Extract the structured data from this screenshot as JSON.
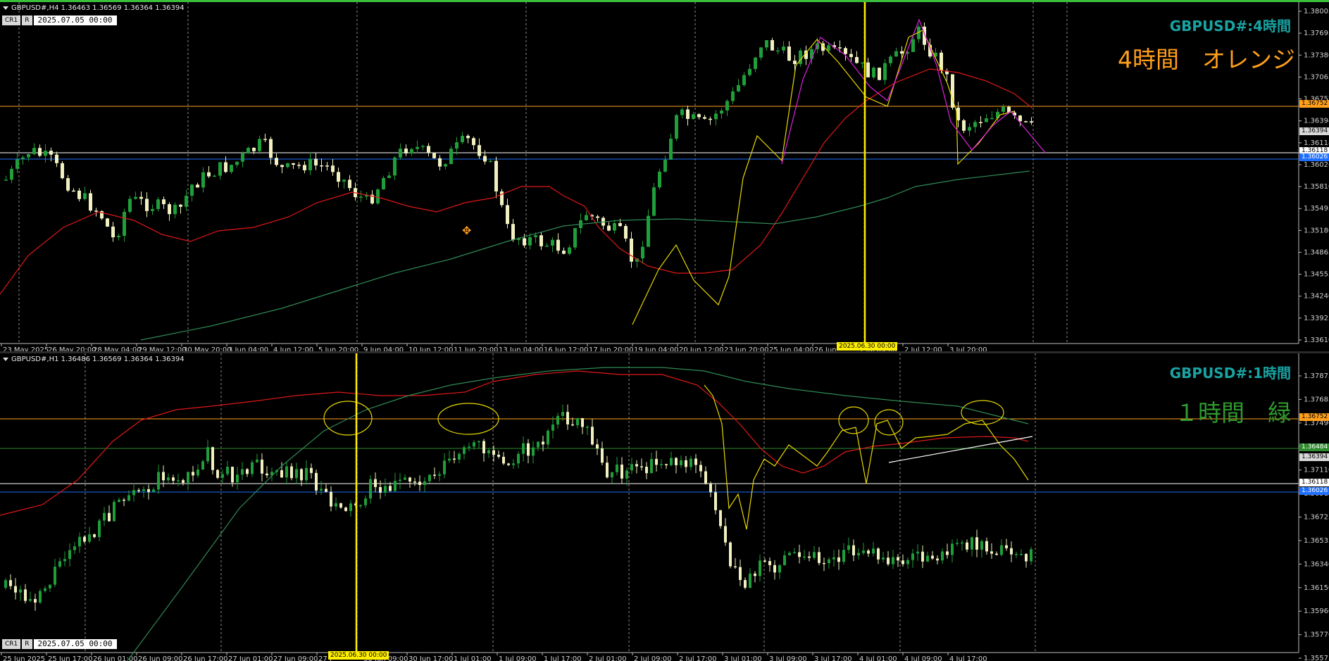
{
  "top": {
    "header": "GBPUSD#,H4  1.36463 1.36569 1.36364 1.36394",
    "ctrl_cr": "CR1",
    "ctrl_r": "R",
    "ctrl_date": "2025.07.05 00:00",
    "label_title": "GBPUSD#:4時間",
    "label_sub": "4時間　オレンジ",
    "price_ticks": [
      "1.38005",
      "1.37695",
      "1.37380",
      "1.37065",
      "1.36752",
      "1.36394",
      "1.36118",
      "1.36026",
      "1.35810",
      "1.35495",
      "1.35180",
      "1.34865",
      "1.34555",
      "1.34240",
      "1.33925",
      "1.33610"
    ],
    "price_tags": [
      {
        "text": "1.36752",
        "bg": "#ff9f1c",
        "fg": "#000"
      },
      {
        "text": "1.36394",
        "bg": "#d8d8d8",
        "fg": "#000"
      },
      {
        "text": "1.36118",
        "bg": "#ffffff",
        "fg": "#000"
      },
      {
        "text": "1.36026",
        "bg": "#1e6fff",
        "fg": "#fff"
      }
    ],
    "time_ticks": [
      "23 May 2025",
      "26 May 20:00",
      "28 May 04:00",
      "29 May 12:00",
      "30 May 20:00",
      "3 Jun 04:00",
      "4 Jun 12:00",
      "5 Jun 20:00",
      "9 Jun 04:00",
      "10 Jun 12:00",
      "11 Jun 20:00",
      "13 Jun 04:00",
      "16 Jun 12:00",
      "17 Jun 20:00",
      "19 Jun 04:00",
      "20 Jun 12:00",
      "23 Jun 20:00",
      "25 Jun 04:00",
      "26 Jun",
      "1 Jul 04:00",
      "2 Jul 12:00",
      "3 Jul 20:00"
    ],
    "vline_label": "2025.06.30 00:00"
  },
  "bottom": {
    "header": "GBPUSD#,H1  1.36486 1.36569 1.36364 1.36394",
    "ctrl_cr": "CR1",
    "ctrl_r": "R",
    "ctrl_date": "2025.07.05 00:00",
    "label_title": "GBPUSD#:1時間",
    "label_sub": "１時間　緑",
    "price_ticks": [
      "1.37875",
      "1.37685",
      "1.37490",
      "1.37300",
      "1.37110",
      "1.36915",
      "1.36725",
      "1.36535",
      "1.36340",
      "1.36150",
      "1.35960",
      "1.35770",
      "1.35575"
    ],
    "price_tags": [
      {
        "text": "1.36752",
        "bg": "#ff9f1c",
        "fg": "#000"
      },
      {
        "text": "1.36484",
        "bg": "#2e8b2e",
        "fg": "#fff"
      },
      {
        "text": "1.36394",
        "bg": "#d8d8d8",
        "fg": "#000"
      },
      {
        "text": "1.36118",
        "bg": "#ffffff",
        "fg": "#000"
      },
      {
        "text": "1.36026",
        "bg": "#1e6fff",
        "fg": "#fff"
      }
    ],
    "time_ticks": [
      "25 Jun 2025",
      "25 Jun 17:00",
      "26 Jun 01:00",
      "26 Jun 09:00",
      "26 Jun 17:00",
      "27 Jun 01:00",
      "27 Jun 09:00",
      "27 J",
      "30 Jun 09:00",
      "30 Jun 17:00",
      "1 Jul 01:00",
      "1 Jul 09:00",
      "1 Jul 17:00",
      "2 Jul 01:00",
      "2 Jul 09:00",
      "2 Jul 17:00",
      "3 Jul 01:00",
      "3 Jul 09:00",
      "3 Jul 17:00",
      "4 Jul 01:00",
      "4 Jul 09:00",
      "4 Jul 17:00"
    ],
    "vline_label": "2025.06.30 00:00"
  },
  "colors": {
    "bull": "#1f9e3a",
    "bear": "#f0f0c0",
    "ma_red": "#e01818",
    "ma_green": "#2f8a55",
    "zigzag_yellow": "#e8d800",
    "zigzag_magenta": "#e020e0",
    "vline": "#ffee00",
    "orange_line": "#ff9f1c",
    "blue_line": "#1e6fff",
    "title_teal": "#1aa3a3",
    "sub_orange": "#ff9f1c",
    "sub_green": "#2e9a2e"
  }
}
